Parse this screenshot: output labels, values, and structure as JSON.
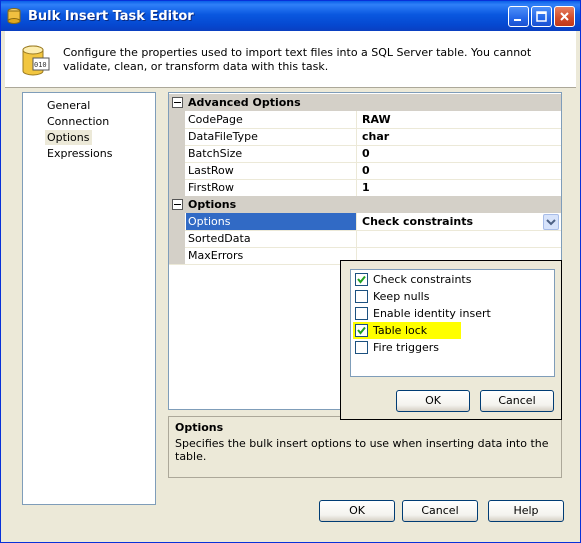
{
  "window": {
    "title": "Bulk Insert Task Editor"
  },
  "header": {
    "description": "Configure the properties used to import text files into a SQL Server table. You cannot validate, clean, or transform data with this task."
  },
  "nav": {
    "items": [
      {
        "label": "General"
      },
      {
        "label": "Connection"
      },
      {
        "label": "Options",
        "selected": true
      },
      {
        "label": "Expressions"
      }
    ]
  },
  "grid": {
    "categories": [
      {
        "name": "Advanced Options",
        "rows": [
          {
            "name": "CodePage",
            "value": "RAW"
          },
          {
            "name": "DataFileType",
            "value": "char"
          },
          {
            "name": "BatchSize",
            "value": "0"
          },
          {
            "name": "LastRow",
            "value": "0"
          },
          {
            "name": "FirstRow",
            "value": "1"
          }
        ]
      },
      {
        "name": "Options",
        "rows": [
          {
            "name": "Options",
            "value": "Check constraints",
            "selected": true
          },
          {
            "name": "SortedData",
            "value": ""
          },
          {
            "name": "MaxErrors",
            "value": ""
          }
        ]
      }
    ]
  },
  "popup": {
    "items": [
      {
        "label": "Check constraints",
        "checked": true
      },
      {
        "label": "Keep nulls",
        "checked": false
      },
      {
        "label": "Enable identity insert",
        "checked": false
      },
      {
        "label": "Table lock",
        "checked": true,
        "highlight": "#ffff00"
      },
      {
        "label": "Fire triggers",
        "checked": false
      }
    ],
    "ok_label": "OK",
    "cancel_label": "Cancel"
  },
  "help_panel": {
    "title": "Options",
    "description": "Specifies the bulk insert options to use when inserting data into the table."
  },
  "footer": {
    "ok_label": "OK",
    "cancel_label": "Cancel",
    "help_label": "Help"
  },
  "colors": {
    "titlebar": "#0a58e0",
    "selection": "#316ac5",
    "highlight": "#ffff00",
    "dialog_bg": "#ece9d8"
  }
}
